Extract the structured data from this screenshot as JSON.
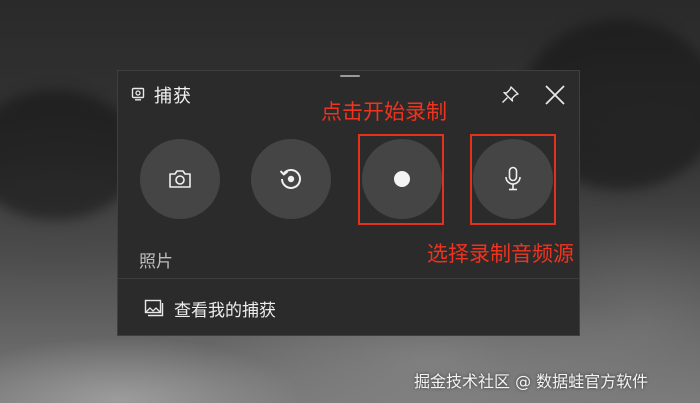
{
  "window": {
    "title": "捕获",
    "icons": {
      "app": "webcam-icon",
      "pin": "pin-icon",
      "close": "close-icon"
    }
  },
  "capture_buttons": [
    {
      "icon": "camera-icon",
      "action": "screenshot"
    },
    {
      "icon": "replay-icon",
      "action": "record-last-30s"
    },
    {
      "icon": "record-dot-icon",
      "action": "start-recording"
    },
    {
      "icon": "microphone-icon",
      "action": "audio-source"
    }
  ],
  "mode_label": "照片",
  "view_captures": {
    "icon": "gallery-icon",
    "label": "查看我的捕获"
  },
  "annotations": {
    "start_recording": "点击开始录制",
    "audio_source": "选择录制音频源",
    "color": "#e3311e"
  },
  "watermark": "掘金技术社区 @ 数据蛙官方软件"
}
